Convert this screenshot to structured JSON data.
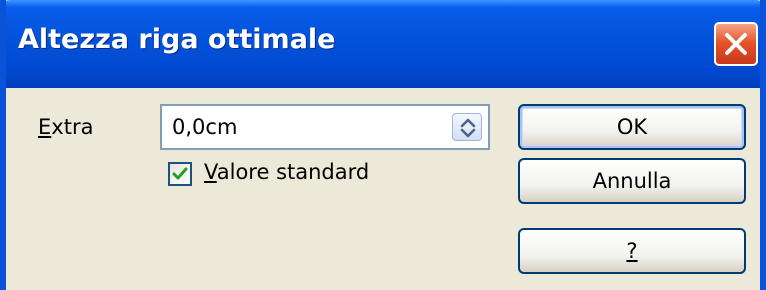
{
  "window": {
    "title": "Altezza riga ottimale",
    "close_icon": "close-icon"
  },
  "extra": {
    "label_mnemonic": "E",
    "label_rest": "xtra",
    "value": "0,0cm",
    "spin_icon": "spin-up-down-icon"
  },
  "default_value": {
    "checked": true,
    "label_mnemonic": "V",
    "label_rest": "alore standard"
  },
  "buttons": {
    "ok": "OK",
    "cancel": "Annulla",
    "help": "?"
  },
  "colors": {
    "titlebar": "#0251da",
    "dialog_bg": "#ece9d8",
    "close_button": "#e4552d",
    "checkmark": "#21a121"
  }
}
